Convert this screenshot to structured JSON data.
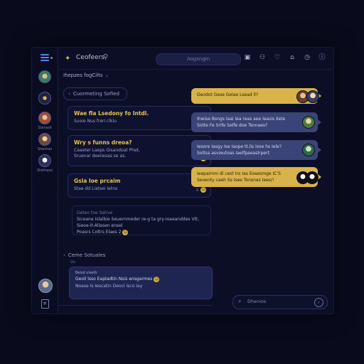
{
  "app": {
    "title": "Ceofeers",
    "search_placeholder": "Aogsngin"
  },
  "breadcrumb": {
    "label": "Ihepzes fogCilts",
    "chevron": "⌄"
  },
  "rail": {
    "items": [
      {
        "label": ""
      },
      {
        "label": ""
      },
      {
        "label": "Stanaot"
      },
      {
        "label": "Stannas"
      },
      {
        "label": "Stethaos"
      }
    ]
  },
  "section1": {
    "label": "Cuormeting Sofied"
  },
  "cards": [
    {
      "title": "Wae fla Lsedony fo Intdl.",
      "sub": "Suoie Nus freri clkiu",
      "meta": "e2"
    },
    {
      "title": "Wry s funns dreoa?",
      "sub": "Ceaeter Laeps Gisandoat Phet,",
      "sub2": "Sruenar deeiiesas se as.",
      "meta": "2"
    },
    {
      "title": "Gsla Ioe prcaim",
      "sub": "Stae dd Liatsei Ietns",
      "meta": "s"
    }
  ],
  "note": {
    "head": "Deteo toe Setive",
    "line1": "Siceane Islalbie Seuernmeder re-g ta gry-Ioaeanddes Vtt,",
    "line2": "Sieoe-lt-Allasen ensel",
    "line3": "Poasrs Coltrs Elaes 2"
  },
  "section2": {
    "label": "Ceme Sotuales",
    "sub": "Ou"
  },
  "panel2": {
    "head": "Beisd ulesth",
    "line1": "Geoil lsso Eapladtin Nsis ensgarmes",
    "line2": "Noase Is Iescatin Deocl Isco Iay"
  },
  "messages": [
    {
      "style": "gold",
      "line1": "Deodot Gese Gelae Lsead ll?"
    },
    {
      "style": "slate",
      "line1": "Ihwise Bsngs Iaai lea reas aee Ieasis Ilete",
      "line2": "Sotte Fe Srife Selfe doe Tsnnaes?"
    },
    {
      "style": "slate",
      "line1": "Iesore Iasgy Ise Iaope tt.lis Isoe hs Iele?",
      "line2": "Sotlsa asvieutoas Iaelfpaeaslrpert"
    },
    {
      "style": "gold",
      "line1": "Ieepaimm dl cest Iro Ias Eosesmge IC'S",
      "line2": "Seoenty caeh Ss Isee Tonsnes Iees/!"
    }
  ],
  "chat_input": {
    "placeholder": "Dhenios"
  },
  "colors": {
    "accent": "#e0b546",
    "bubble_gold": "#d8b34a",
    "bubble_slate": "#3b4476",
    "bg": "#090b1d"
  },
  "icons": [
    "menu-icon",
    "chat-app-icon",
    "pin-icon",
    "camera-icon",
    "user-icon",
    "heart-icon",
    "bell-icon",
    "clock-icon",
    "info-icon",
    "search-icon",
    "send-icon",
    "document-icon"
  ]
}
